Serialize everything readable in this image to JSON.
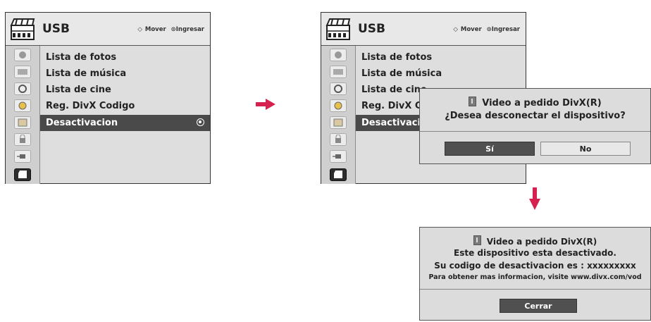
{
  "menu": {
    "title": "USB",
    "hint_move": "Mover",
    "hint_enter": "Ingresar",
    "items": [
      {
        "label": "Lista de fotos"
      },
      {
        "label": "Lista de música"
      },
      {
        "label": "Lista de cine"
      },
      {
        "label": "Reg. DivX Codigo"
      },
      {
        "label": "Desactivacion"
      }
    ],
    "side_icons": [
      "picture-icon",
      "tv-icon",
      "speaker-icon",
      "clock-icon",
      "film-icon",
      "lock-icon",
      "plug-icon",
      "usb-clapper-icon"
    ],
    "colors": {
      "background": "#dedede",
      "highlight": "#4a4a4a",
      "arrow": "#d6204f"
    }
  },
  "menu2_items": [
    {
      "label": "Lista de fotos"
    },
    {
      "label": "Lista de música"
    },
    {
      "label": "Lista de cine"
    },
    {
      "label": "Reg. DivX Codigo"
    },
    {
      "label": "Desactivacion"
    }
  ],
  "confirm_dialog": {
    "title": "Video a pedido DivX(R)",
    "question": "¿Desea desconectar el dispositivo?",
    "yes": "Sí",
    "no": "No"
  },
  "result_dialog": {
    "title": "Video a pedido DivX(R)",
    "line1": "Este dispositivo esta desactivado.",
    "line2": "Su codigo de desactivacion es : xxxxxxxxx",
    "line3": "Para obtener mas informacion, visite www.divx.com/vod",
    "close": "Cerrar"
  }
}
